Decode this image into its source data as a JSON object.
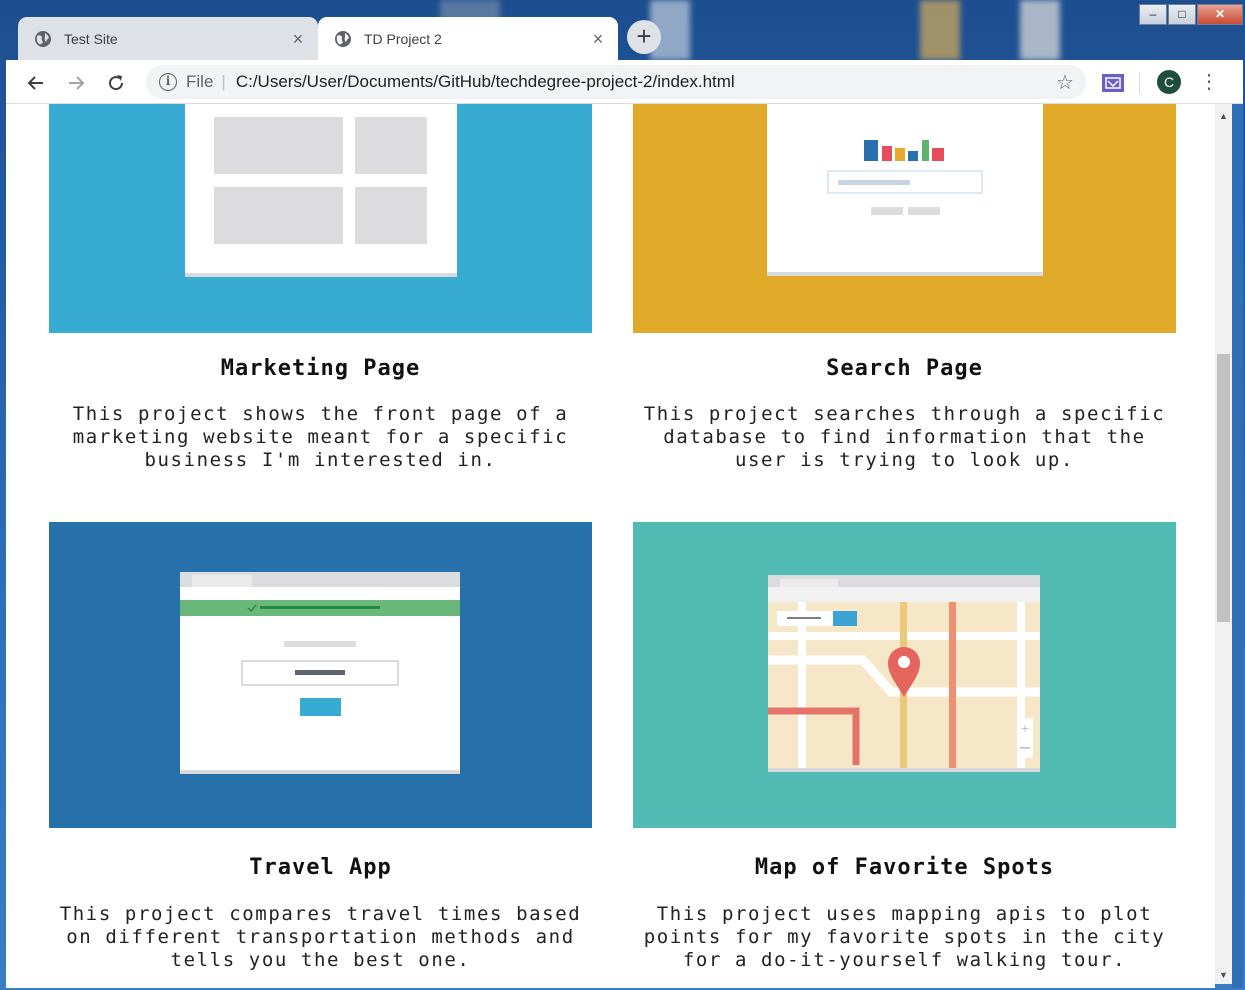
{
  "browser": {
    "tabs": [
      {
        "title": "Test Site",
        "active": false
      },
      {
        "title": "TD Project 2",
        "active": true
      }
    ],
    "address": {
      "scheme_label": "File",
      "url": "C:/Users/User/Documents/GitHub/techdegree-project-2/index.html"
    },
    "profile_initial": "C"
  },
  "projects": [
    {
      "title": "Marketing Page",
      "description": "This project shows the front page of a marketing website meant for a specific business I'm interested in.",
      "thumb_color": "#37abd1"
    },
    {
      "title": "Search Page",
      "description": "This project searches through a specific database to find information that the user is trying to look up.",
      "thumb_color": "#e0aa28"
    },
    {
      "title": "Travel App",
      "description": "This project compares travel times based on different transportation methods and tells you the best one.",
      "thumb_color": "#2771aa"
    },
    {
      "title": "Map of Favorite Spots",
      "description": "This project uses mapping apis to plot points for my favorite spots in the city for a do-it-yourself walking tour.",
      "thumb_color": "#52bbb4"
    }
  ]
}
